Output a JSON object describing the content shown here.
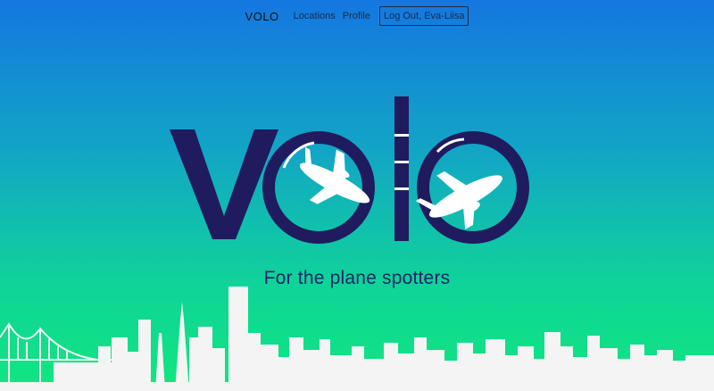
{
  "nav": {
    "brand": "VOLO",
    "links": [
      "Locations",
      "Profile"
    ],
    "logout_label": "Log Out, Eva-Liisa"
  },
  "hero": {
    "logo_text": "volo",
    "tagline": "For the plane spotters"
  },
  "colors": {
    "logo": "#1f1b5e",
    "tagline": "#1f2366",
    "skyline": "#f4f4f4",
    "gradient_top": "#1477e0",
    "gradient_bottom": "#10e77e"
  },
  "icons": [
    "airplane-icon",
    "city-skyline-icon",
    "bridge-icon"
  ]
}
